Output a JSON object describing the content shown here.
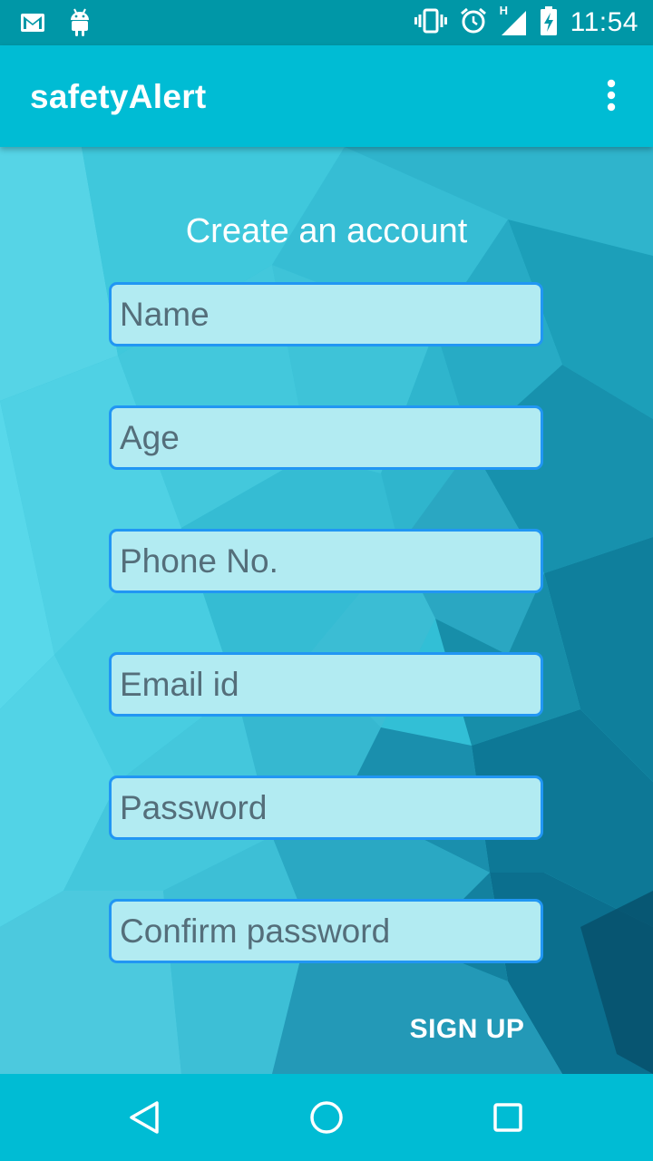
{
  "status_bar": {
    "time": "11:54",
    "network_type": "H",
    "icons": [
      "gmail-icon",
      "android-icon",
      "vibrate-icon",
      "alarm-icon",
      "signal-icon",
      "battery-charging-icon"
    ]
  },
  "app_bar": {
    "title": "safetyAlert",
    "overflow_icon": "more-vert-icon"
  },
  "form": {
    "heading": "Create an account",
    "fields": [
      {
        "placeholder": "Name",
        "value": ""
      },
      {
        "placeholder": "Age",
        "value": ""
      },
      {
        "placeholder": "Phone No.",
        "value": ""
      },
      {
        "placeholder": "Email id",
        "value": ""
      },
      {
        "placeholder": "Password",
        "value": ""
      },
      {
        "placeholder": "Confirm password",
        "value": ""
      }
    ],
    "submit_label": "SIGN UP"
  },
  "nav_bar": {
    "buttons": [
      "back-icon",
      "home-icon",
      "recents-icon"
    ]
  },
  "colors": {
    "status_bar": "#0097a7",
    "app_bar": "#00bcd4",
    "field_bg": "#b2ebf2",
    "field_border": "#2196f3"
  }
}
